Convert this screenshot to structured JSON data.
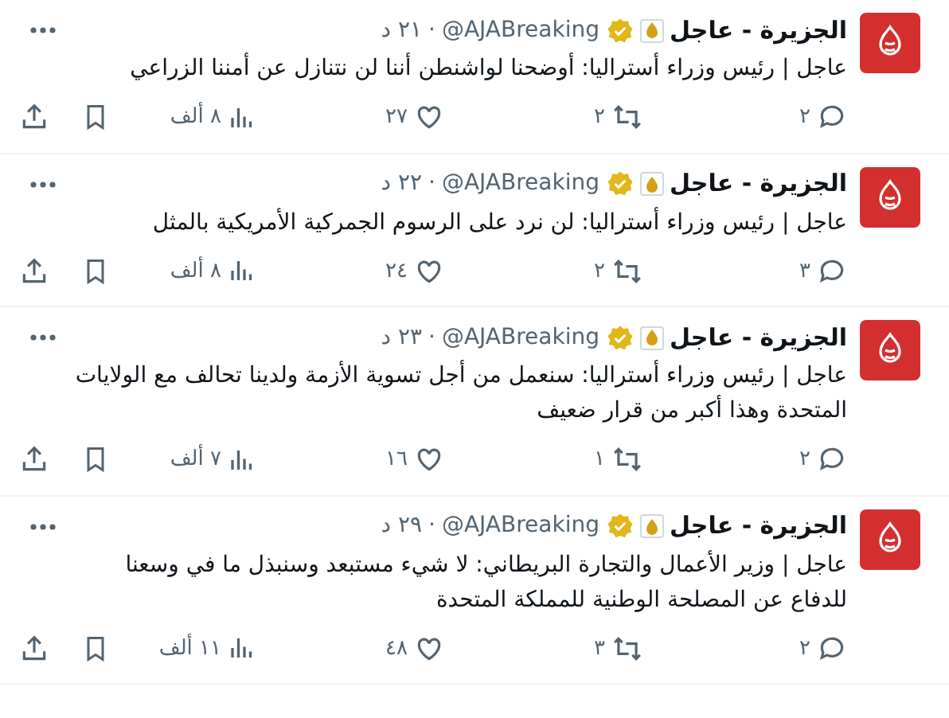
{
  "tweets": [
    {
      "name": "الجزيرة - عاجل",
      "handle": "@AJABreaking",
      "separator": "·",
      "time": "٢١ د",
      "verified": true,
      "text": "عاجل | رئيس وزراء أستراليا: أوضحنا لواشنطن أننا لن نتنازل عن أمننا الزراعي",
      "replies": "٢",
      "retweets": "٢",
      "likes": "٢٧",
      "views": "٨ ألف"
    },
    {
      "name": "الجزيرة - عاجل",
      "handle": "@AJABreaking",
      "separator": "·",
      "time": "٢٢ د",
      "verified": true,
      "text": "عاجل | رئيس وزراء أستراليا: لن نرد على الرسوم الجمركية الأمريكية بالمثل",
      "replies": "٣",
      "retweets": "٢",
      "likes": "٢٤",
      "views": "٨ ألف"
    },
    {
      "name": "الجزيرة - عاجل",
      "handle": "@AJABreaking",
      "separator": "·",
      "time": "٢٣ د",
      "verified": true,
      "text": "عاجل | رئيس وزراء أستراليا: سنعمل من أجل تسوية الأزمة ولدينا تحالف مع الولايات المتحدة وهذا أكبر من قرار ضعيف",
      "replies": "٢",
      "retweets": "١",
      "likes": "١٦",
      "views": "٧ ألف"
    },
    {
      "name": "الجزيرة - عاجل",
      "handle": "@AJABreaking",
      "separator": "·",
      "time": "٢٩ د",
      "verified": true,
      "text": "عاجل | وزير الأعمال والتجارة البريطاني: لا شيء مستبعد وسنبذل ما في وسعنا للدفاع عن المصلحة الوطنية للمملكة المتحدة",
      "replies": "٢",
      "retweets": "٣",
      "likes": "٤٨",
      "views": "١١ ألف"
    }
  ]
}
